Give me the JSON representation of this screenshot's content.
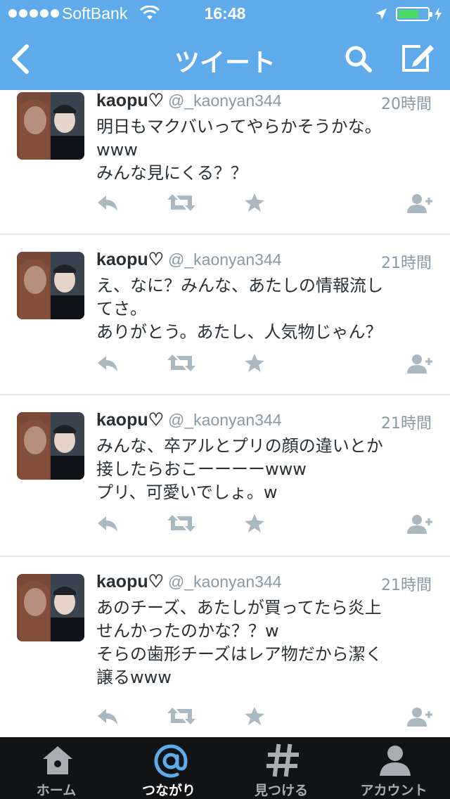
{
  "status_bar": {
    "carrier": "SoftBank",
    "time": "16:48",
    "battery_fill_fraction": 0.7
  },
  "nav": {
    "title": "ツイート",
    "icons": [
      "back-icon",
      "search-icon",
      "compose-icon"
    ]
  },
  "colors": {
    "nav_background": "#5eaaeb",
    "tab_bar_background": "#111314",
    "active_tab": "#5eaaeb",
    "action_icon": "#aab8c2",
    "handle_text": "#8899a6",
    "battery_fill": "#4cd964"
  },
  "tweets": [
    {
      "name": "kaopu♡",
      "handle": "@_kaonyan344",
      "time": "20時間",
      "text": "明日もマクバいってやらかそうかな。\nwww\nみんな見にくる？？"
    },
    {
      "name": "kaopu♡",
      "handle": "@_kaonyan344",
      "time": "21時間",
      "text": "え、なに？みんな、あたしの情報流し\nてさ。\nありがとう。あたし、人気物じゃん？"
    },
    {
      "name": "kaopu♡",
      "handle": "@_kaonyan344",
      "time": "21時間",
      "text": "みんな、卒アルとプリの顔の違いとか\n接したらおこーーーーwww\nプリ、可愛いでしょ。w"
    },
    {
      "name": "kaopu♡",
      "handle": "@_kaonyan344",
      "time": "21時間",
      "text": "あのチーズ、あたしが買ってたら炎上\nせんかったのかな？？w\nそらの歯形チーズはレア物だから潔く\n譲るwww"
    }
  ],
  "tab_bar": {
    "tabs": [
      {
        "label": "ホーム",
        "icon": "home-icon",
        "active": false
      },
      {
        "label": "つながり",
        "icon": "at-icon",
        "active": true
      },
      {
        "label": "見つける",
        "icon": "hashtag-icon",
        "active": false
      },
      {
        "label": "アカウント",
        "icon": "account-icon",
        "active": false
      }
    ]
  }
}
